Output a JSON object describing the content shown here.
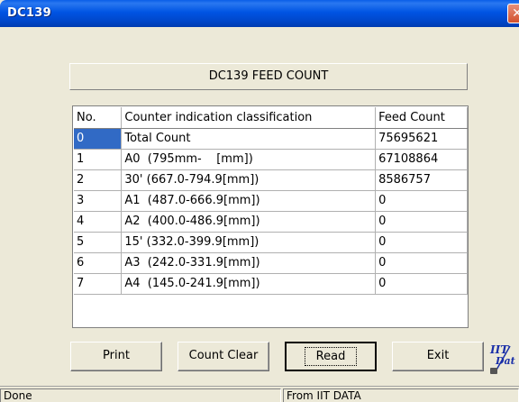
{
  "window": {
    "title": "DC139",
    "close_glyph": "✕"
  },
  "heading": "DC139 FEED COUNT",
  "grid": {
    "columns": [
      "No.",
      "Counter indication classification",
      "Feed Count"
    ],
    "rows": [
      {
        "no": "0",
        "label": "Total Count",
        "count": "75695621"
      },
      {
        "no": "1",
        "label": "A0  (795mm-    [mm])",
        "count": "67108864"
      },
      {
        "no": "2",
        "label": "30' (667.0-794.9[mm])",
        "count": "8586757"
      },
      {
        "no": "3",
        "label": "A1  (487.0-666.9[mm])",
        "count": "0"
      },
      {
        "no": "4",
        "label": "A2  (400.0-486.9[mm])",
        "count": "0"
      },
      {
        "no": "5",
        "label": "15' (332.0-399.9[mm])",
        "count": "0"
      },
      {
        "no": "6",
        "label": "A3  (242.0-331.9[mm])",
        "count": "0"
      },
      {
        "no": "7",
        "label": "A4  (145.0-241.9[mm])",
        "count": "0"
      }
    ]
  },
  "buttons": {
    "print": "Print",
    "count_clear": "Count Clear",
    "read": "Read",
    "exit": "Exit"
  },
  "logo": {
    "icon": "iit-data-logo-icon",
    "text": "IIT DATA"
  },
  "status": {
    "left": "Done",
    "right": "From IIT DATA"
  },
  "colors": {
    "titlebar": "#0054e3",
    "selection": "#316ac5",
    "face": "#ece9d8"
  }
}
